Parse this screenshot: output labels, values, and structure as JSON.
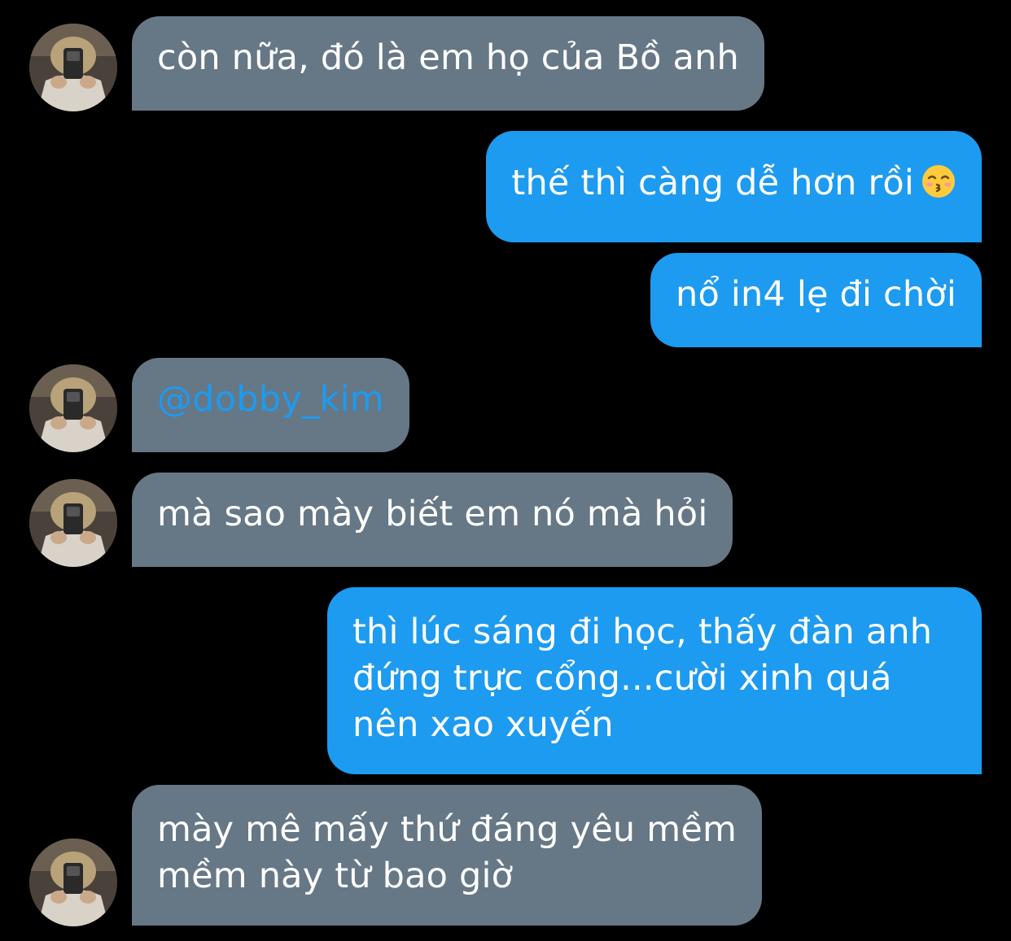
{
  "conversation": {
    "messages": [
      {
        "side": "in",
        "lines": [
          "còn nữa, đó là em họ của Bồ anh"
        ]
      },
      {
        "side": "out",
        "lines": [
          "thế thì càng dễ hơn rồi"
        ],
        "emoji": "kissing-face-with-closed-eyes-emoji"
      },
      {
        "side": "out",
        "lines": [
          "nổ in4 lẹ đi chời"
        ]
      },
      {
        "side": "in",
        "lines": [
          "@dobby_kim"
        ],
        "mention": true
      },
      {
        "side": "in",
        "lines": [
          "mà sao mày biết em nó mà hỏi"
        ]
      },
      {
        "side": "out",
        "lines": [
          "thì lúc sáng đi học, thấy đàn anh",
          "đứng trực cổng...cười xinh quá",
          "nên xao xuyến"
        ]
      },
      {
        "side": "in",
        "lines": [
          "mày mê mấy thứ đáng yêu mềm",
          "mềm này từ bao giờ"
        ]
      }
    ]
  },
  "colors": {
    "background": "#000000",
    "incoming_bubble": "#667786",
    "outgoing_bubble": "#1d9bf0",
    "mention": "#1d9bf0",
    "text": "#ffffff"
  }
}
